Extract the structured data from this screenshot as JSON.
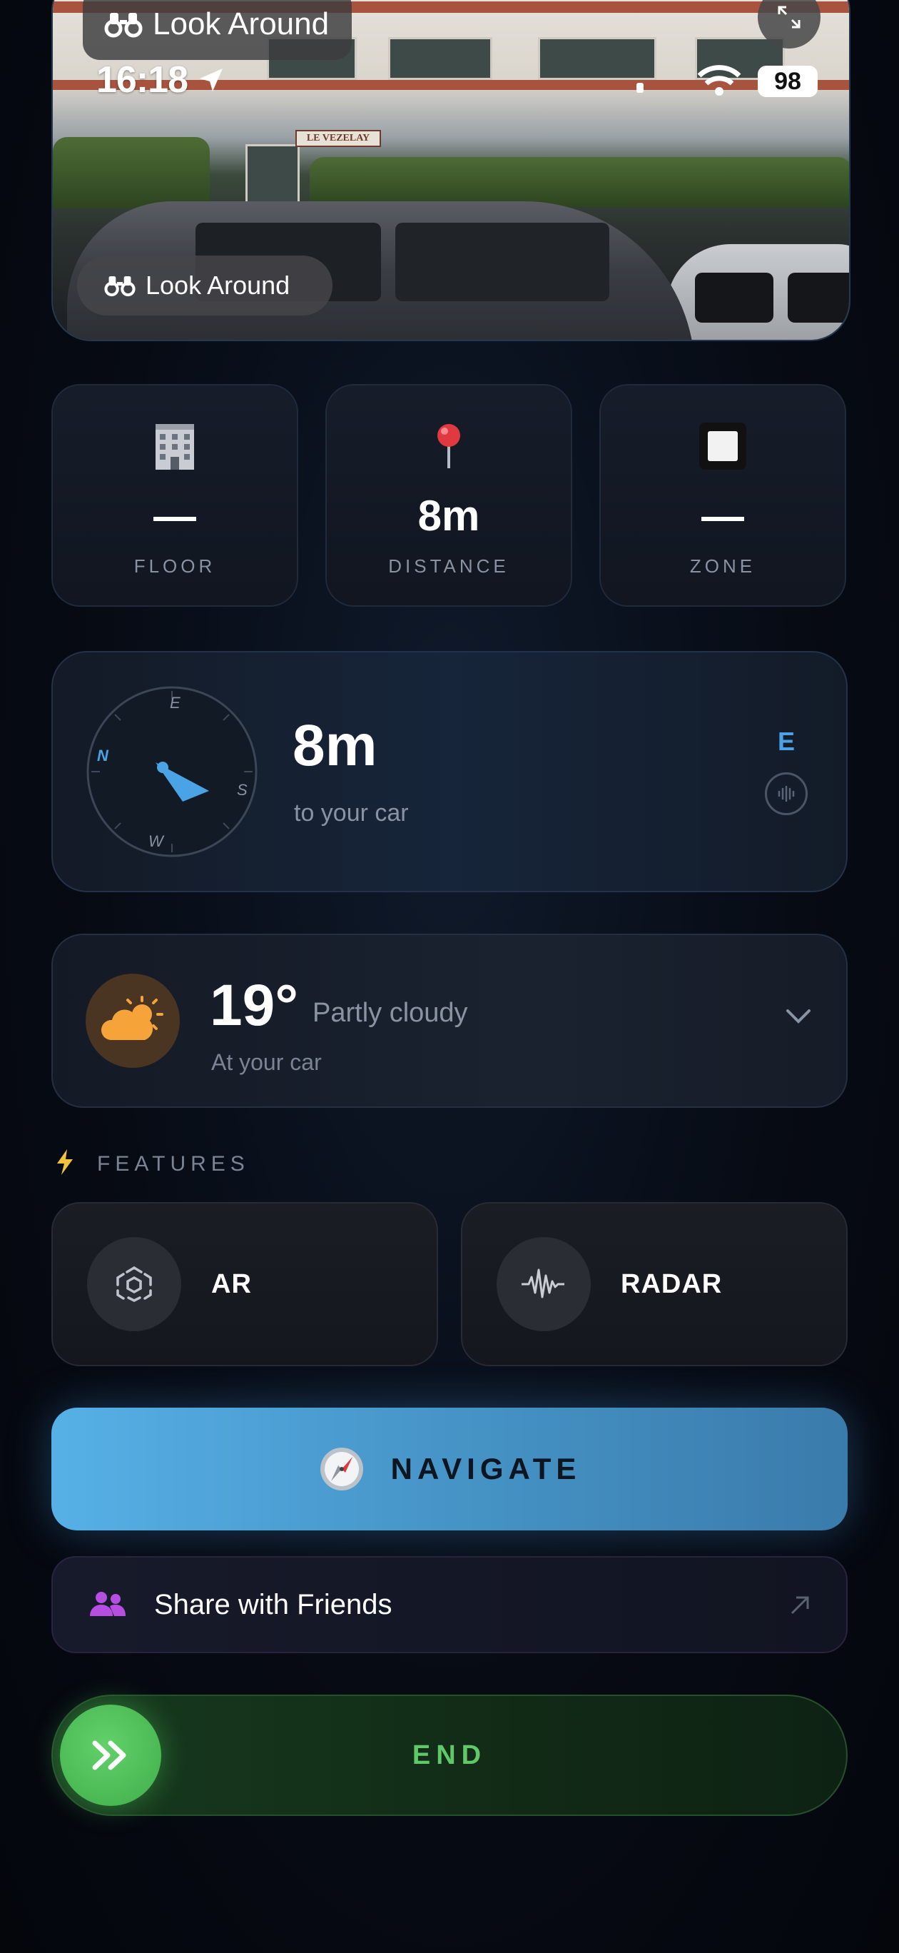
{
  "status_bar": {
    "time": "16:18",
    "battery": "98"
  },
  "look_around": {
    "top_label": "Look Around",
    "button_label": "Look Around",
    "sign_text": "LE VEZELAY"
  },
  "stats": {
    "floor": {
      "value": "—",
      "label": "FLOOR",
      "icon": "building-icon"
    },
    "distance": {
      "value": "8m",
      "label": "DISTANCE",
      "icon": "pin-icon"
    },
    "zone": {
      "value": "—",
      "label": "ZONE",
      "icon": "square-icon"
    }
  },
  "compass": {
    "distance": "8m",
    "subtitle": "to your car",
    "heading": "E",
    "letters": {
      "north": "N",
      "east": "E",
      "south": "S",
      "west": "W"
    }
  },
  "weather": {
    "temp": "19°",
    "condition": "Partly cloudy",
    "location": "At your car",
    "icon": "partly-cloudy-icon"
  },
  "features": {
    "title": "FEATURES",
    "ar_label": "AR",
    "radar_label": "RADAR"
  },
  "navigate": {
    "label": "NAVIGATE"
  },
  "share": {
    "label": "Share with Friends"
  },
  "end": {
    "label": "END"
  },
  "colors": {
    "accent_blue": "#4a9fd8",
    "end_green": "#5fc867",
    "share_purple": "#b44fe0"
  }
}
